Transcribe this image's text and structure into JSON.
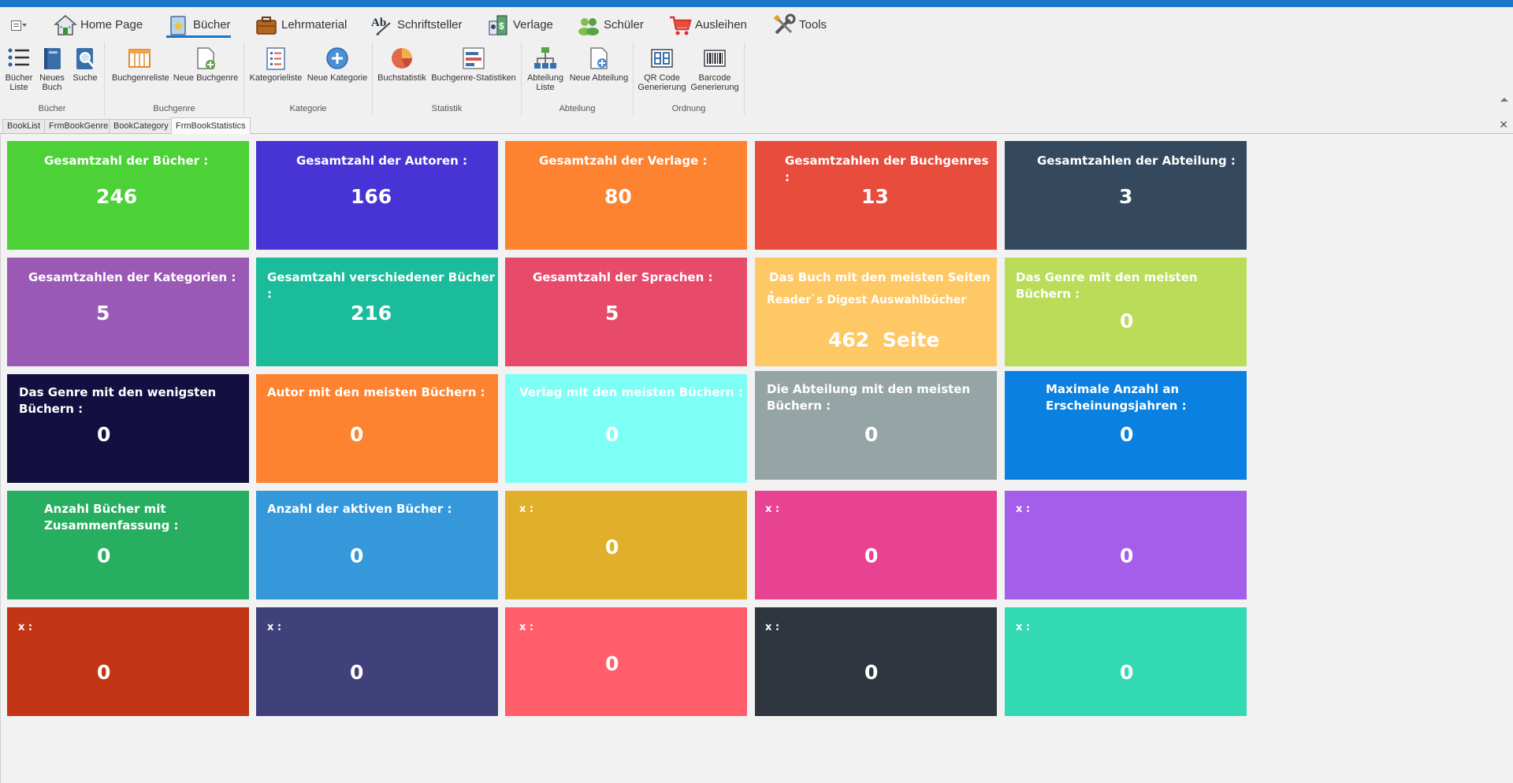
{
  "menu": {
    "tabs": [
      {
        "label": "Home Page",
        "icon": "house-icon"
      },
      {
        "label": "Bücher",
        "icon": "book-icon"
      },
      {
        "label": "Lehrmaterial",
        "icon": "briefcase-icon"
      },
      {
        "label": "Schriftsteller",
        "icon": "writing-icon"
      },
      {
        "label": "Verlage",
        "icon": "publisher-icon"
      },
      {
        "label": "Schüler",
        "icon": "students-icon"
      },
      {
        "label": "Ausleihen",
        "icon": "cart-icon"
      },
      {
        "label": "Tools",
        "icon": "tools-icon"
      }
    ],
    "active": "Bücher"
  },
  "ribbon": {
    "groups": [
      {
        "name": "Bücher",
        "buttons": [
          "Bücher\nListe",
          "Neues\nBuch",
          "Suche"
        ]
      },
      {
        "name": "Buchgenre",
        "buttons": [
          "Buchgenreliste",
          "Neue Buchgenre"
        ]
      },
      {
        "name": "Kategorie",
        "buttons": [
          "Kategorieliste",
          "Neue Kategorie"
        ]
      },
      {
        "name": "Statistik",
        "buttons": [
          "Buchstatistik",
          "Buchgenre-Statistiken"
        ]
      },
      {
        "name": "Abteilung",
        "buttons": [
          "Abteilung\nListe",
          "Neue Abteilung"
        ]
      },
      {
        "name": "Ordnung",
        "buttons": [
          "QR Code\nGenerierung",
          "Barcode\nGenerierung"
        ]
      }
    ]
  },
  "doc_tabs": [
    "BookList",
    "FrmBookGenre",
    "BookCategory",
    "FrmBookStatistics"
  ],
  "doc_tabs_close": "✕",
  "colors": {
    "green": "#4cd137",
    "indigo": "#4834d4",
    "orange": "#fd8331",
    "red": "#e84c3d",
    "slate": "#34495e",
    "purple": "#9b59b6",
    "teal": "#1abc9c",
    "rose": "#e84b6a",
    "peach": "#fec865",
    "lime": "#badc58",
    "navy": "#130f40",
    "aqua": "#7efff5",
    "gray": "#95a5a6",
    "blue": "#0a80e0"
  },
  "tiles": [
    {
      "title": "Gesamtzahl der Bücher :",
      "value": "246"
    },
    {
      "title": "Gesamtzahl der Autoren :",
      "value": "166"
    },
    {
      "title": "Gesamtzahl der Verlage :",
      "value": "80"
    },
    {
      "title": "Gesamtzahlen der Buchgenres :",
      "value": "13"
    },
    {
      "title": "Gesamtzahlen der Abteilung :",
      "value": "3"
    },
    {
      "title": "Gesamtzahlen der Kategorien :",
      "value": "5"
    },
    {
      "title": "Gesamtzahl verschiedener Bücher :",
      "value": "216"
    },
    {
      "title": "Gesamtzahl der Sprachen :",
      "value": "5"
    },
    {
      "title": "Das Buch mit den meisten Seiten :",
      "subtitle": "Reader`s Digest Auswahlbücher",
      "value": "462",
      "unit": "Seite"
    },
    {
      "title": "Das Genre mit den meisten Büchern :",
      "value": "0"
    },
    {
      "title": "Das Genre mit den wenigsten\nBüchern :",
      "value": "0"
    },
    {
      "title": "Autor mit den meisten Büchern :",
      "value": "0"
    },
    {
      "title": "Verlag mit den meisten Büchern :",
      "value": "0"
    },
    {
      "title": "Die Abteilung mit den meisten\nBüchern :",
      "value": "0"
    },
    {
      "title": "Maximale Anzahl an\nErscheinungsjahren :",
      "value": "0"
    },
    {
      "title": "Anzahl Bücher mit\nZusammenfassung :",
      "value": "0"
    },
    {
      "title": "Anzahl der aktiven Bücher :",
      "value": "0"
    },
    {
      "title": "x :",
      "value": "0"
    },
    {
      "title": "x :",
      "value": "0"
    },
    {
      "title": "x :",
      "value": "0"
    },
    {
      "title": "x :",
      "value": "0"
    },
    {
      "title": "x :",
      "value": "0"
    },
    {
      "title": "x :",
      "value": "0"
    },
    {
      "title": "x :",
      "value": "0"
    },
    {
      "title": "x :",
      "value": "0"
    }
  ]
}
